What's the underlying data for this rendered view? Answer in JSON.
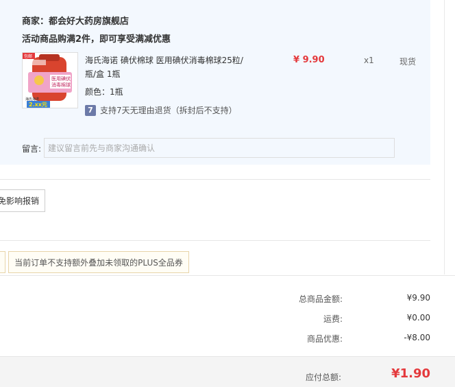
{
  "shop": {
    "merchant_label": "商家：都会好大药房旗舰店",
    "promo_text": "活动商品购满2件，即可享受满减优惠"
  },
  "product": {
    "title": "海氏海诺 碘伏棉球 医用碘伏消毒棉球25粒/瓶/盒 1瓶",
    "price": "¥ 9.90",
    "quantity": "x1",
    "stock": "现货",
    "color": "颜色：1瓶",
    "return_icon_text": "7",
    "return_policy": "支持7天无理由退货（拆封后不支持）",
    "thumb_badge": "包邮",
    "thumb_label_1": "医用碘伏",
    "thumb_label_2": "消毒棉球",
    "thumb_price": "2.xx元",
    "thumb_brand": "海氏海诺"
  },
  "note": {
    "label": "留言:",
    "placeholder": "建议留言前先与商家沟通确认"
  },
  "invoice": {
    "button_text": "免影响报销"
  },
  "coupon": {
    "notice": "当前订单不支持额外叠加未领取的PLUS全品券"
  },
  "summary": {
    "goods_total_label": "总商品金额:",
    "goods_total_value": "¥9.90",
    "shipping_label": "运费:",
    "shipping_value": "¥0.00",
    "discount_label": "商品优惠:",
    "discount_value": "-¥8.00",
    "payable_label": "应付总额:",
    "payable_value": "¥1.90"
  },
  "colors": {
    "accent_red": "#e4393c",
    "panel_bg": "#f3f8fe",
    "return_icon_bg": "#6c7aa8"
  }
}
